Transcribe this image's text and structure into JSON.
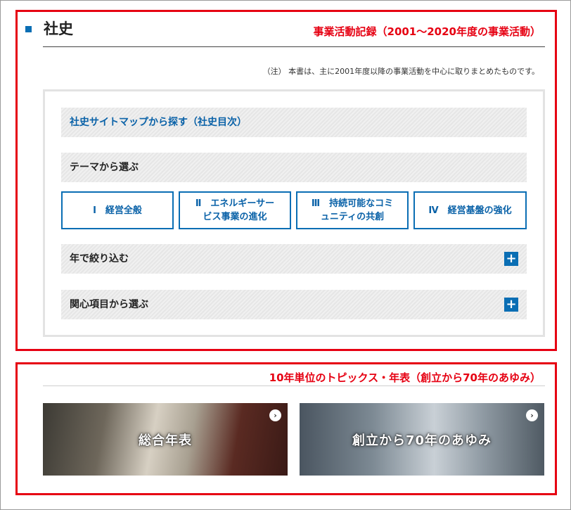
{
  "section1": {
    "title": "社史",
    "annotation": "事業活動記録（2001～2020年度の事業活動）",
    "note": "（注） 本書は、主に2001年度以降の事業活動を中心に取りまとめたものです。",
    "sitemap_label": "社史サイトマップから探す（社史目次）",
    "theme_heading": "テーマから選ぶ",
    "theme_buttons": [
      {
        "line1": "Ⅰ　経営全般",
        "line2": ""
      },
      {
        "line1": "Ⅱ　エネルギーサー",
        "line2": "ビス事業の進化"
      },
      {
        "line1": "Ⅲ　持続可能なコミ",
        "line2": "ュニティの共創"
      },
      {
        "line1": "Ⅳ　経営基盤の強化",
        "line2": ""
      }
    ],
    "year_filter_label": "年で絞り込む",
    "topic_label": "関心項目から選ぶ",
    "expand_symbol": "+"
  },
  "section2": {
    "annotation": "10年単位のトピックス・年表（創立から70年のあゆみ）",
    "cards": [
      {
        "label": "総合年表"
      },
      {
        "label": "創立から70年のあゆみ"
      }
    ],
    "arrow_symbol": "›"
  },
  "colors": {
    "accent_blue": "#0a6eb4",
    "annotation_red": "#e60012"
  }
}
